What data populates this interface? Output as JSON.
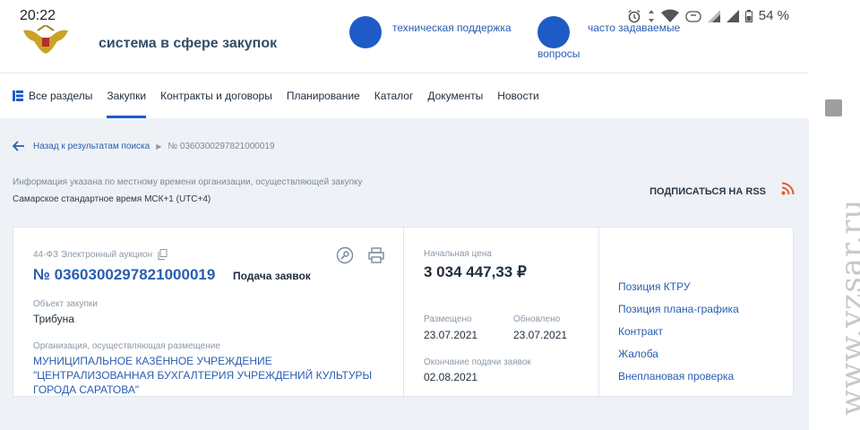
{
  "status_bar": {
    "time": "20:22",
    "battery": "54 %",
    "icons": [
      "alarm-icon",
      "data-arrows-icon",
      "wifi-icon",
      "volte-icon",
      "signal-icon",
      "signal-icon",
      "battery-icon"
    ]
  },
  "header": {
    "site_title": "система в сфере закупок",
    "links": [
      "техническая поддержка",
      "часто задаваемые",
      "вопросы"
    ]
  },
  "nav": {
    "items": [
      {
        "label": "Все разделы",
        "icon": "grid-icon"
      },
      {
        "label": "Закупки",
        "active": true
      },
      {
        "label": "Контракты и договоры"
      },
      {
        "label": "Планирование"
      },
      {
        "label": "Каталог"
      },
      {
        "label": "Документы"
      },
      {
        "label": "Новости"
      }
    ]
  },
  "breadcrumb": {
    "back": "Назад к результатам поиска",
    "current": "№ 0360300297821000019"
  },
  "timezone": {
    "info": "Информация указана по местному времени организации, осуществляющей закупку",
    "value": "Самарское стандартное время МСК+1 (UTC+4)"
  },
  "rss": {
    "label": "ПОДПИСАТЬСЯ НА RSS",
    "color": "#e8592d"
  },
  "purchase": {
    "law": "44-ФЗ Электронный аукцион",
    "number": "№ 0360300297821000019",
    "stage": "Подача заявок",
    "object_label": "Объект закупки",
    "object_value": "Трибуна",
    "org_label": "Организация, осуществляющая размещение",
    "org_value": "МУНИЦИПАЛЬНОЕ КАЗЁННОЕ УЧРЕЖДЕНИЕ \"ЦЕНТРАЛИЗОВАННАЯ БУХГАЛТЕРИЯ УЧРЕЖДЕНИЙ КУЛЬТУРЫ ГОРОДА САРАТОВА\"",
    "price_label": "Начальная цена",
    "price": "3 034 447,33 ₽",
    "placed_label": "Размещено",
    "placed": "23.07.2021",
    "updated_label": "Обновлено",
    "updated": "23.07.2021",
    "deadline_label": "Окончание подачи заявок",
    "deadline": "02.08.2021"
  },
  "side_links": [
    "Позиция КТРУ",
    "Позиция плана-графика",
    "Контракт",
    "Жалоба",
    "Внеплановая проверка"
  ],
  "watermark": "www.vzsar.ru",
  "colors": {
    "accent": "#1f5bc6",
    "link": "#2a5db0",
    "background": "#eef2f6"
  }
}
